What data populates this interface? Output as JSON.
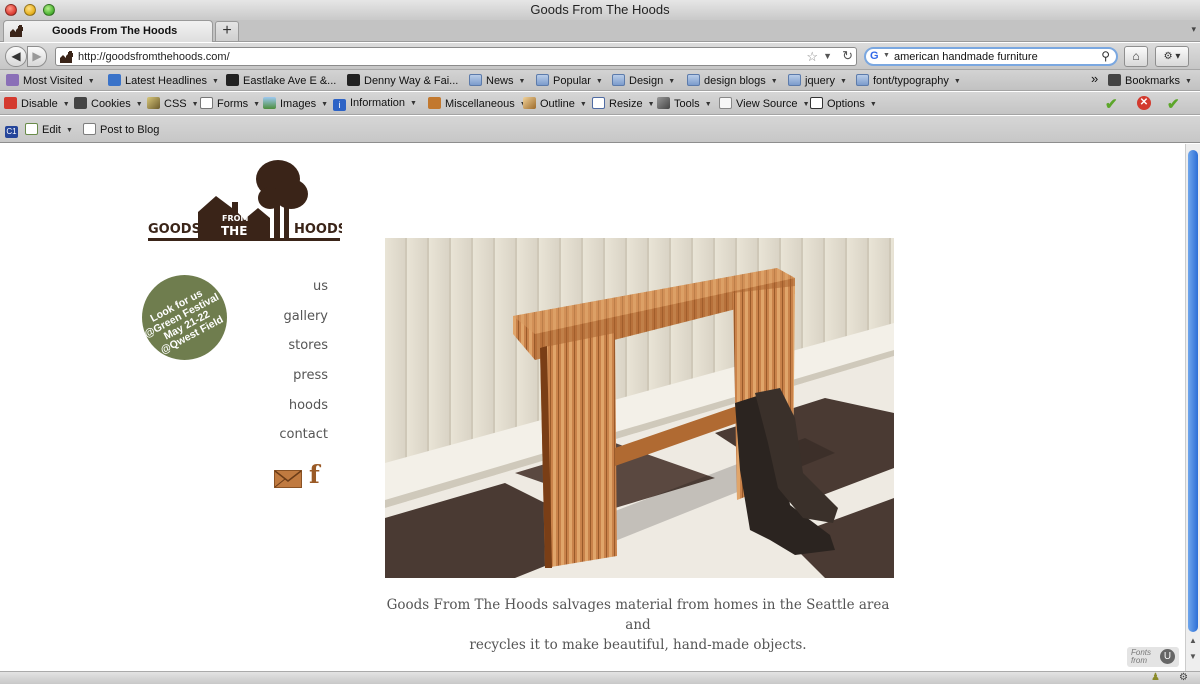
{
  "window": {
    "title": "Goods From The Hoods"
  },
  "tab": {
    "label": "Goods From The Hoods",
    "new_tab_label": "+"
  },
  "nav": {
    "back_icon": "◀",
    "forward_icon": "▶",
    "url": "http://goodsfromthehoods.com/",
    "search_query": "american handmade furniture",
    "home_icon": "⌂"
  },
  "bookmarks": [
    {
      "label": "Most Visited",
      "icon": "most-visited-icon",
      "menu": true
    },
    {
      "label": "Latest Headlines",
      "icon": "rss-icon",
      "menu": true
    },
    {
      "label": "Eastlake Ave E &...",
      "icon": "bus-icon",
      "menu": false
    },
    {
      "label": "Denny Way & Fai...",
      "icon": "bus-icon",
      "menu": false
    },
    {
      "label": "News",
      "icon": "folder-icon",
      "menu": true
    },
    {
      "label": "Popular",
      "icon": "folder-icon",
      "menu": true
    },
    {
      "label": "Design",
      "icon": "folder-icon",
      "menu": true
    },
    {
      "label": "design blogs",
      "icon": "folder-icon",
      "menu": true
    },
    {
      "label": "jquery",
      "icon": "folder-icon",
      "menu": true
    },
    {
      "label": "font/typography",
      "icon": "folder-icon",
      "menu": true
    }
  ],
  "bookmarks_overflow": "»",
  "bookmarks_menu": "Bookmarks",
  "devtoolbar": [
    {
      "label": "Disable",
      "icon": "disable-icon"
    },
    {
      "label": "Cookies",
      "icon": "cookies-icon"
    },
    {
      "label": "CSS",
      "icon": "css-icon"
    },
    {
      "label": "Forms",
      "icon": "forms-icon"
    },
    {
      "label": "Images",
      "icon": "images-icon"
    },
    {
      "label": "Information",
      "icon": "information-icon"
    },
    {
      "label": "Miscellaneous",
      "icon": "miscellaneous-icon"
    },
    {
      "label": "Outline",
      "icon": "outline-icon"
    },
    {
      "label": "Resize",
      "icon": "resize-icon"
    },
    {
      "label": "Tools",
      "icon": "tools-icon"
    },
    {
      "label": "View Source",
      "icon": "view-source-icon"
    },
    {
      "label": "Options",
      "icon": "options-icon"
    }
  ],
  "blogbar": {
    "edit": "Edit",
    "post": "Post to Blog",
    "c1_badge": "C1"
  },
  "site": {
    "logo": {
      "goods": "GOODS",
      "from": "FROM",
      "the": "THE",
      "hoods": "HOODS"
    },
    "badge_lines": [
      "Look for us",
      "@Green Festival",
      "May 21-22",
      "@Qwest Field"
    ],
    "badge_color": "#6f7d4e",
    "menu": [
      "us",
      "gallery",
      "stores",
      "press",
      "hoods",
      "contact"
    ],
    "social_icons": [
      "mail-icon",
      "facebook-icon"
    ],
    "facebook_glyph": "f",
    "caption_lines": [
      "Goods From The Hoods salvages material from homes in the Seattle area and",
      "recycles it to make beautiful, hand-made objects."
    ],
    "fonts_from": [
      "Fonts",
      "from"
    ],
    "fonts_from_glyph": "U"
  },
  "colors": {
    "brand_dark": "#3a2418",
    "accent": "#9a5a26",
    "link": "#555555",
    "scroll_thumb": "#2c6fd6"
  }
}
